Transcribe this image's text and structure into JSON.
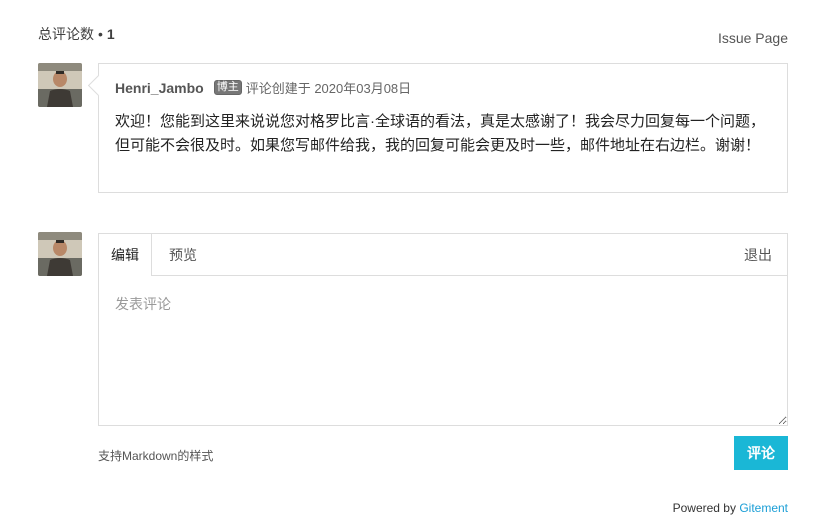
{
  "header": {
    "count_label": "总评论数",
    "separator": "•",
    "count": "1",
    "issue_link": "Issue Page"
  },
  "comments": [
    {
      "author": "Henri_Jambo",
      "badge": "博主",
      "date_text": "评论创建于 2020年03月08日",
      "body": "欢迎！您能到这里来说说您对格罗比言·全球语的看法，真是太感谢了！我会尽力回复每一个问题，但可能不会很及时。如果您写邮件给我，我的回复可能会更及时一些，邮件地址在右边栏。谢谢！"
    }
  ],
  "editor": {
    "tab_edit": "编辑",
    "tab_preview": "预览",
    "logout": "退出",
    "placeholder": "发表评论",
    "value": "",
    "markdown_tip": "支持Markdown的样式",
    "submit": "评论"
  },
  "footer": {
    "powered_by": "Powered by",
    "brand": "Gitement"
  },
  "colors": {
    "accent": "#1ab7d6",
    "link": "#1a9ed6",
    "border": "#dddddd"
  }
}
